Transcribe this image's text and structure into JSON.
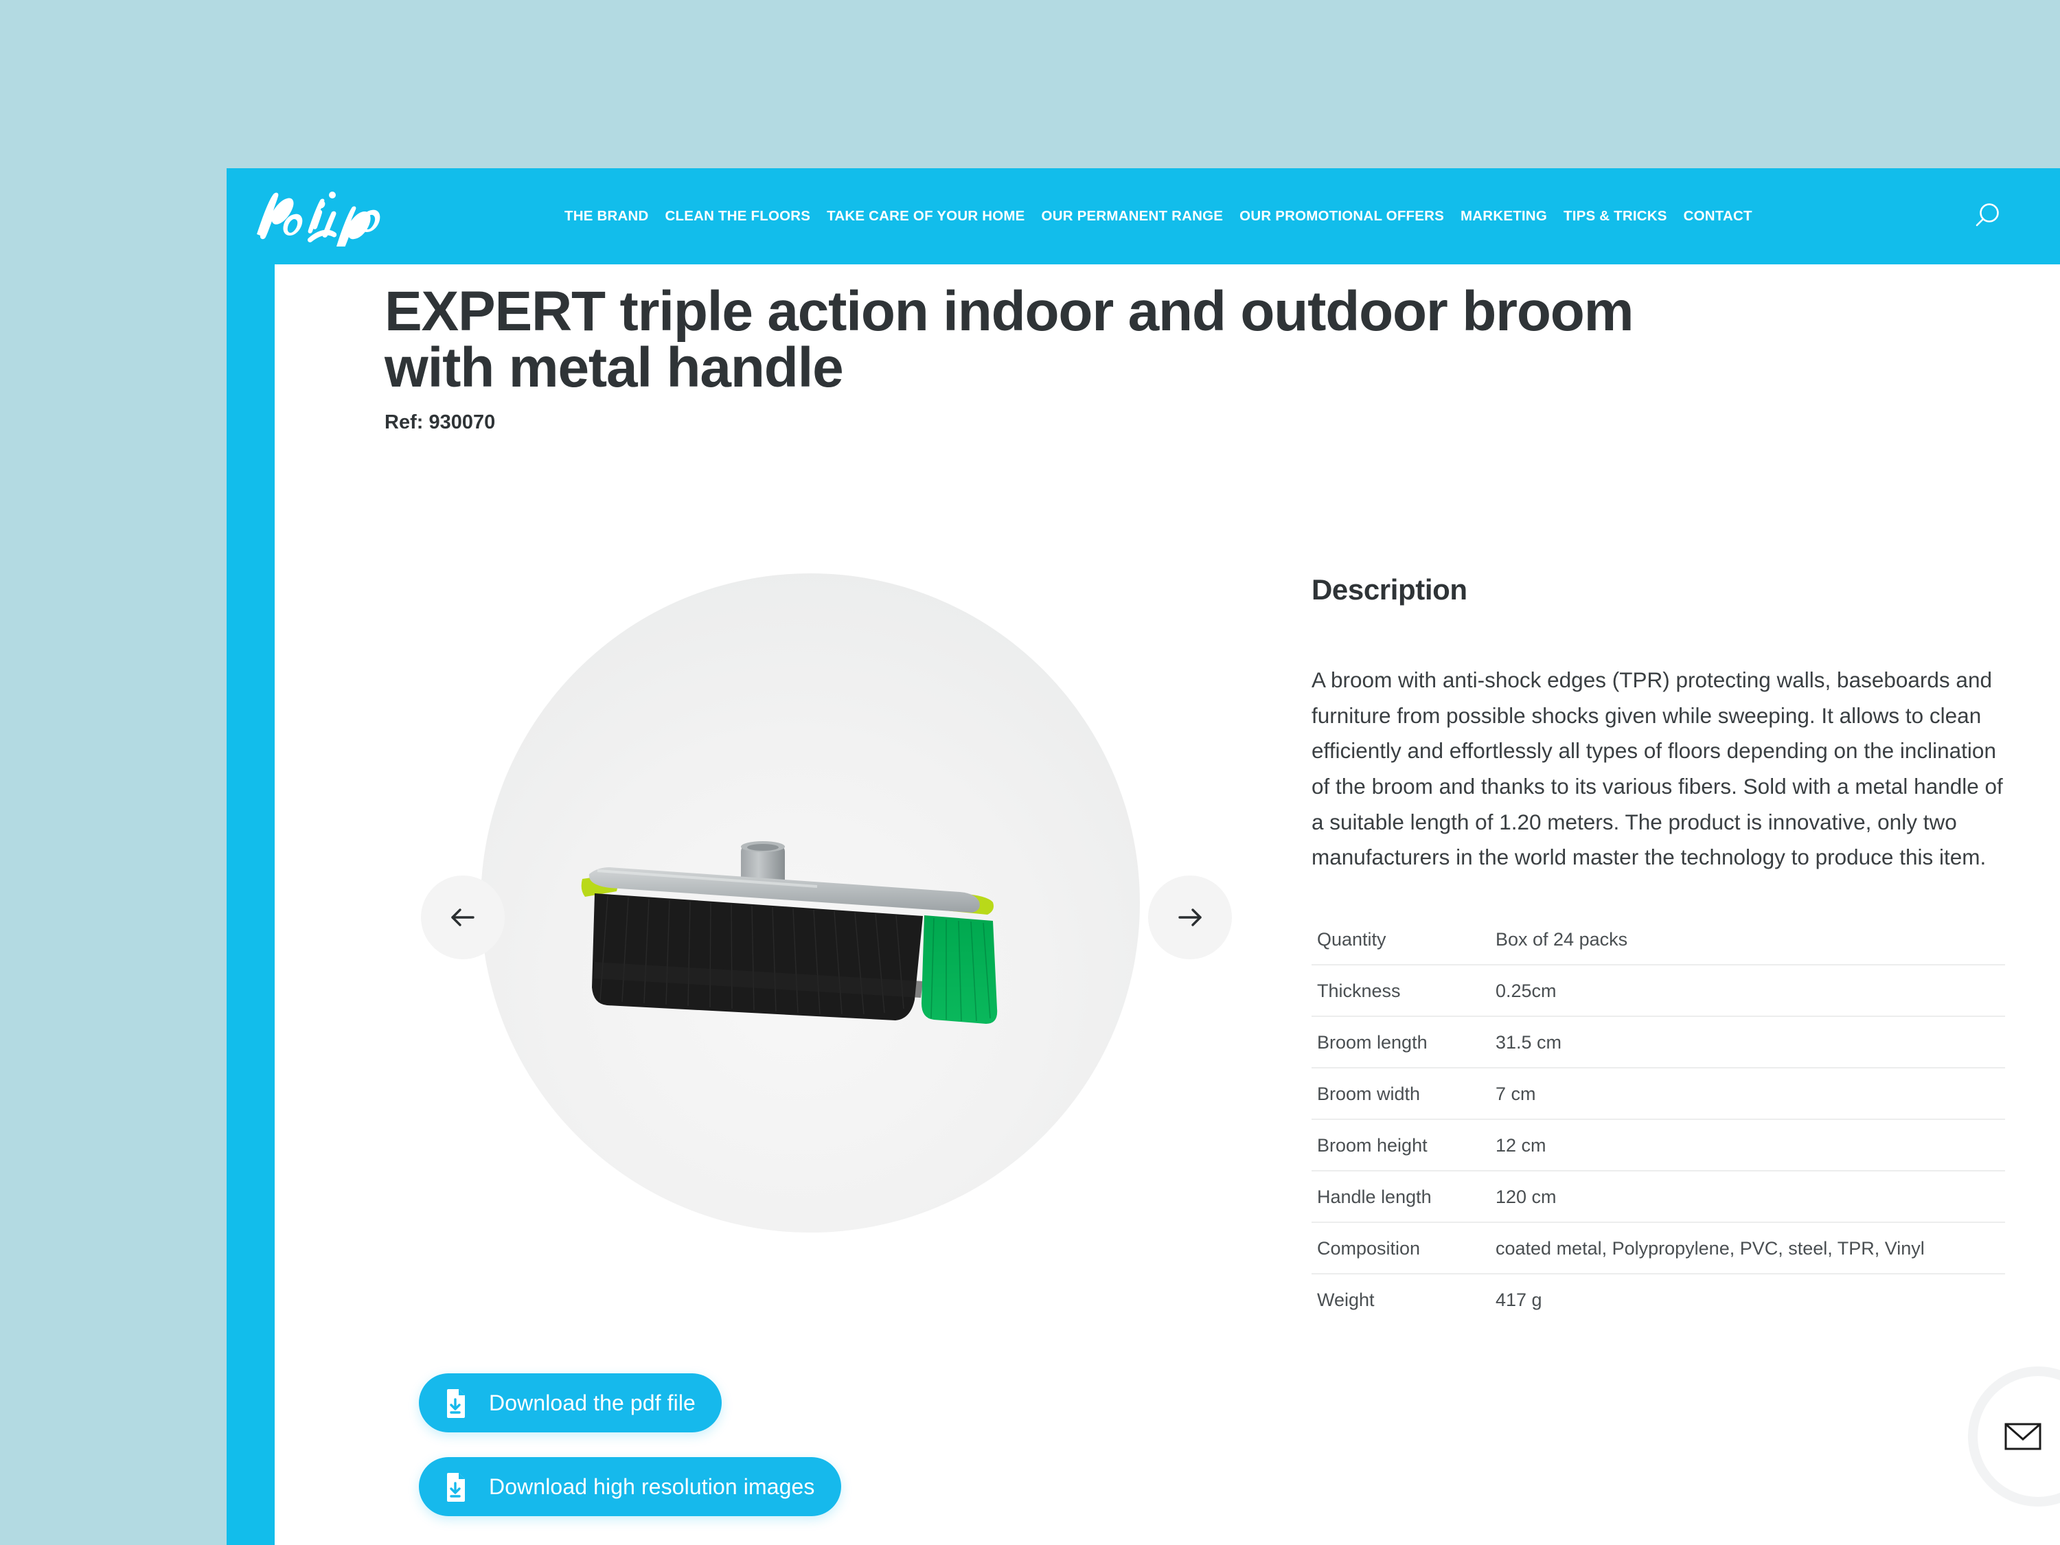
{
  "theme": {
    "brand_blue": "#12bdeb",
    "button_blue": "#16b9ec",
    "page_backdrop": "#b3dae2",
    "text_dark": "#2f3437"
  },
  "header": {
    "logo_text": "pol.hop",
    "logo_icon": "polhop-script-logo",
    "search_icon": "search-icon",
    "nav_items": [
      {
        "label": "THE BRAND"
      },
      {
        "label": "CLEAN THE FLOORS"
      },
      {
        "label": "TAKE CARE OF YOUR HOME"
      },
      {
        "label": "OUR PERMANENT RANGE"
      },
      {
        "label": "OUR PROMOTIONAL OFFERS"
      },
      {
        "label": "MARKETING"
      },
      {
        "label": "TIPS & TRICKS"
      },
      {
        "label": "CONTACT"
      }
    ]
  },
  "product": {
    "title": "EXPERT triple action indoor and outdoor broom with metal handle",
    "ref": "Ref: 930070"
  },
  "gallery": {
    "prev_icon": "arrow-left-icon",
    "next_icon": "arrow-right-icon",
    "image_alt": "broom-head-product-photo"
  },
  "downloads": [
    {
      "label": "Download the pdf file",
      "icon": "file-download-icon"
    },
    {
      "label": "Download high resolution images",
      "icon": "file-download-icon"
    }
  ],
  "description": {
    "heading": "Description",
    "body": "A broom with anti-shock edges (TPR) protecting walls, baseboards and furniture from possible shocks given while sweeping. It allows to clean efficiently and effortlessly all types of floors depending on the inclination of the broom and thanks to its various fibers. Sold with a metal handle of a suitable length of 1.20 meters. The product is innovative, only two manufacturers in the world master the technology to produce this item."
  },
  "specs": [
    {
      "key": "Quantity",
      "value": "Box of 24 packs"
    },
    {
      "key": "Thickness",
      "value": "0.25cm"
    },
    {
      "key": "Broom length",
      "value": "31.5 cm"
    },
    {
      "key": "Broom width",
      "value": "7 cm"
    },
    {
      "key": "Broom height",
      "value": "12 cm"
    },
    {
      "key": "Handle length",
      "value": "120 cm"
    },
    {
      "key": "Composition",
      "value": "coated metal, Polypropylene, PVC, steel, TPR, Vinyl"
    },
    {
      "key": "Weight",
      "value": "417 g"
    }
  ],
  "contact_bubble": {
    "icon": "envelope-icon"
  }
}
